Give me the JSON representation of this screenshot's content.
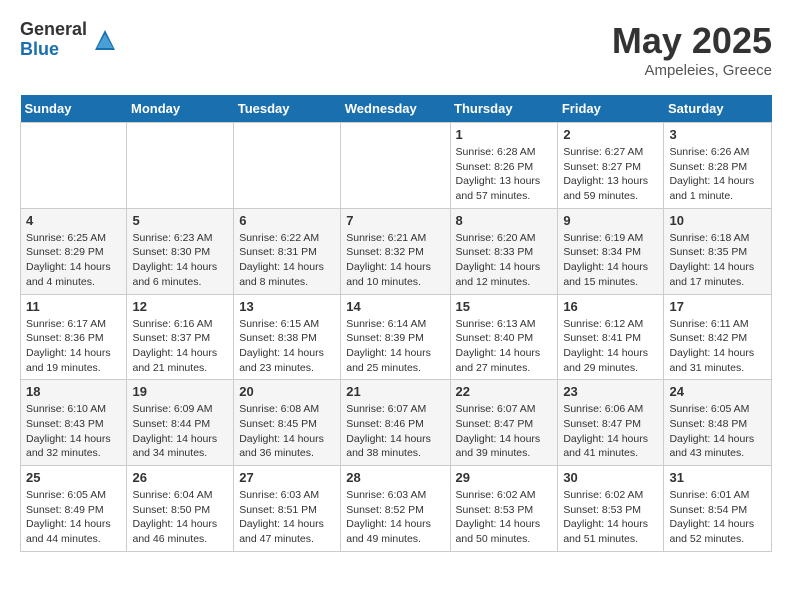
{
  "logo": {
    "general": "General",
    "blue": "Blue"
  },
  "header": {
    "month": "May 2025",
    "location": "Ampeleies, Greece"
  },
  "weekdays": [
    "Sunday",
    "Monday",
    "Tuesday",
    "Wednesday",
    "Thursday",
    "Friday",
    "Saturday"
  ],
  "weeks": [
    [
      {
        "day": "",
        "info": ""
      },
      {
        "day": "",
        "info": ""
      },
      {
        "day": "",
        "info": ""
      },
      {
        "day": "",
        "info": ""
      },
      {
        "day": "1",
        "info": "Sunrise: 6:28 AM\nSunset: 8:26 PM\nDaylight: 13 hours and 57 minutes."
      },
      {
        "day": "2",
        "info": "Sunrise: 6:27 AM\nSunset: 8:27 PM\nDaylight: 13 hours and 59 minutes."
      },
      {
        "day": "3",
        "info": "Sunrise: 6:26 AM\nSunset: 8:28 PM\nDaylight: 14 hours and 1 minute."
      }
    ],
    [
      {
        "day": "4",
        "info": "Sunrise: 6:25 AM\nSunset: 8:29 PM\nDaylight: 14 hours and 4 minutes."
      },
      {
        "day": "5",
        "info": "Sunrise: 6:23 AM\nSunset: 8:30 PM\nDaylight: 14 hours and 6 minutes."
      },
      {
        "day": "6",
        "info": "Sunrise: 6:22 AM\nSunset: 8:31 PM\nDaylight: 14 hours and 8 minutes."
      },
      {
        "day": "7",
        "info": "Sunrise: 6:21 AM\nSunset: 8:32 PM\nDaylight: 14 hours and 10 minutes."
      },
      {
        "day": "8",
        "info": "Sunrise: 6:20 AM\nSunset: 8:33 PM\nDaylight: 14 hours and 12 minutes."
      },
      {
        "day": "9",
        "info": "Sunrise: 6:19 AM\nSunset: 8:34 PM\nDaylight: 14 hours and 15 minutes."
      },
      {
        "day": "10",
        "info": "Sunrise: 6:18 AM\nSunset: 8:35 PM\nDaylight: 14 hours and 17 minutes."
      }
    ],
    [
      {
        "day": "11",
        "info": "Sunrise: 6:17 AM\nSunset: 8:36 PM\nDaylight: 14 hours and 19 minutes."
      },
      {
        "day": "12",
        "info": "Sunrise: 6:16 AM\nSunset: 8:37 PM\nDaylight: 14 hours and 21 minutes."
      },
      {
        "day": "13",
        "info": "Sunrise: 6:15 AM\nSunset: 8:38 PM\nDaylight: 14 hours and 23 minutes."
      },
      {
        "day": "14",
        "info": "Sunrise: 6:14 AM\nSunset: 8:39 PM\nDaylight: 14 hours and 25 minutes."
      },
      {
        "day": "15",
        "info": "Sunrise: 6:13 AM\nSunset: 8:40 PM\nDaylight: 14 hours and 27 minutes."
      },
      {
        "day": "16",
        "info": "Sunrise: 6:12 AM\nSunset: 8:41 PM\nDaylight: 14 hours and 29 minutes."
      },
      {
        "day": "17",
        "info": "Sunrise: 6:11 AM\nSunset: 8:42 PM\nDaylight: 14 hours and 31 minutes."
      }
    ],
    [
      {
        "day": "18",
        "info": "Sunrise: 6:10 AM\nSunset: 8:43 PM\nDaylight: 14 hours and 32 minutes."
      },
      {
        "day": "19",
        "info": "Sunrise: 6:09 AM\nSunset: 8:44 PM\nDaylight: 14 hours and 34 minutes."
      },
      {
        "day": "20",
        "info": "Sunrise: 6:08 AM\nSunset: 8:45 PM\nDaylight: 14 hours and 36 minutes."
      },
      {
        "day": "21",
        "info": "Sunrise: 6:07 AM\nSunset: 8:46 PM\nDaylight: 14 hours and 38 minutes."
      },
      {
        "day": "22",
        "info": "Sunrise: 6:07 AM\nSunset: 8:47 PM\nDaylight: 14 hours and 39 minutes."
      },
      {
        "day": "23",
        "info": "Sunrise: 6:06 AM\nSunset: 8:47 PM\nDaylight: 14 hours and 41 minutes."
      },
      {
        "day": "24",
        "info": "Sunrise: 6:05 AM\nSunset: 8:48 PM\nDaylight: 14 hours and 43 minutes."
      }
    ],
    [
      {
        "day": "25",
        "info": "Sunrise: 6:05 AM\nSunset: 8:49 PM\nDaylight: 14 hours and 44 minutes."
      },
      {
        "day": "26",
        "info": "Sunrise: 6:04 AM\nSunset: 8:50 PM\nDaylight: 14 hours and 46 minutes."
      },
      {
        "day": "27",
        "info": "Sunrise: 6:03 AM\nSunset: 8:51 PM\nDaylight: 14 hours and 47 minutes."
      },
      {
        "day": "28",
        "info": "Sunrise: 6:03 AM\nSunset: 8:52 PM\nDaylight: 14 hours and 49 minutes."
      },
      {
        "day": "29",
        "info": "Sunrise: 6:02 AM\nSunset: 8:53 PM\nDaylight: 14 hours and 50 minutes."
      },
      {
        "day": "30",
        "info": "Sunrise: 6:02 AM\nSunset: 8:53 PM\nDaylight: 14 hours and 51 minutes."
      },
      {
        "day": "31",
        "info": "Sunrise: 6:01 AM\nSunset: 8:54 PM\nDaylight: 14 hours and 52 minutes."
      }
    ]
  ]
}
